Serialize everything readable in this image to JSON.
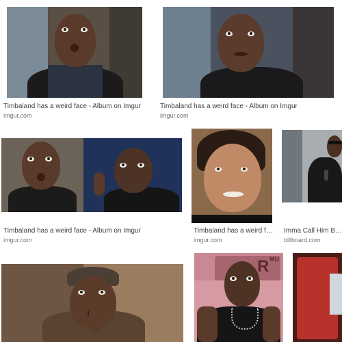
{
  "results": [
    {
      "caption": "Timbaland has a weird face - Album on Imgur",
      "source": "imgur.com"
    },
    {
      "caption": "Timbaland has a weird face - Album on Imgur",
      "source": "imgur.com"
    },
    {
      "caption": "Timbaland has a weird face - Album on Imgur",
      "source": "imgur.com"
    },
    {
      "caption": "Timbaland has a weird fa...",
      "source": "imgur.com"
    },
    {
      "caption": "Imma Call Him Bruce",
      "source": "billboard.com"
    },
    {
      "caption": "",
      "source": ""
    },
    {
      "caption": "",
      "source": ""
    },
    {
      "caption": "",
      "source": ""
    }
  ],
  "thumb_overlays": {
    "poster_top": "R",
    "poster_letters": "MU"
  }
}
